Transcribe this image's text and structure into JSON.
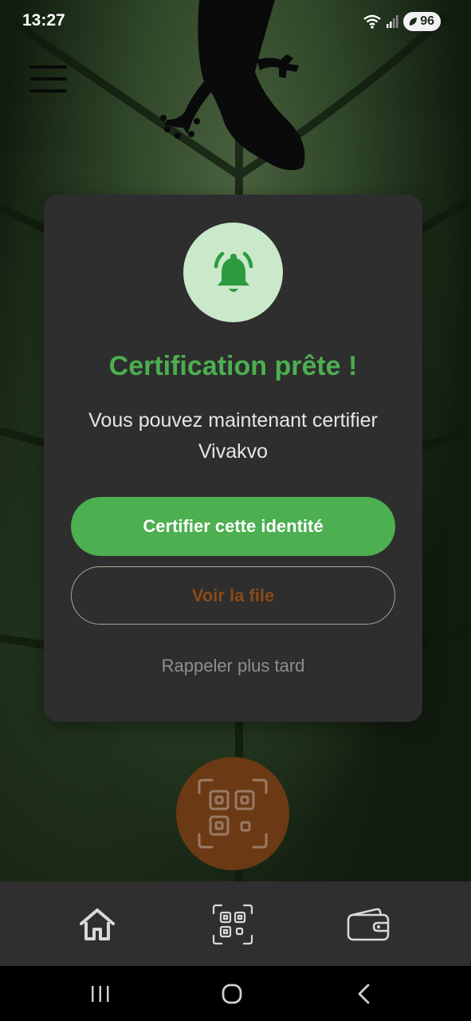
{
  "status_bar": {
    "time": "13:27",
    "battery_level": "96",
    "icons": [
      "wifi-icon",
      "signal-icon",
      "battery-icon"
    ]
  },
  "header": {
    "menu_icon": "hamburger-menu-icon"
  },
  "dialog": {
    "icon": "bell-ringing-icon",
    "title": "Certification prête !",
    "message": "Vous pouvez maintenant certifier Vivakvo",
    "primary_button": "Certifier cette identité",
    "secondary_button": "Voir la file",
    "tertiary_link": "Rappeler plus tard"
  },
  "fab": {
    "icon": "qr-scan-icon"
  },
  "bottom_nav": {
    "items": [
      {
        "icon": "home-icon"
      },
      {
        "icon": "qr-code-icon"
      },
      {
        "icon": "wallet-icon"
      }
    ]
  },
  "system_nav": {
    "items": [
      "recent-apps-icon",
      "home-circle-icon",
      "back-icon"
    ]
  },
  "colors": {
    "accent_green": "#4caf50",
    "bell_background": "#c9e9ca",
    "dialog_background": "#2e2e2e",
    "secondary_text": "#8b4a16",
    "fab_background": "#6b3a14",
    "nav_background": "#2f2f2f"
  }
}
